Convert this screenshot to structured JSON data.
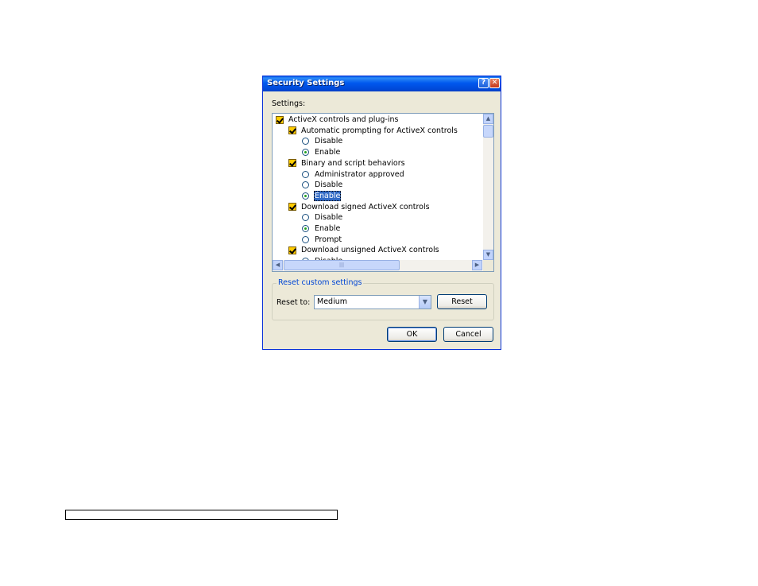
{
  "dialog": {
    "title": "Security Settings",
    "help_glyph": "?",
    "close_glyph": "✕"
  },
  "settings_label": "Settings:",
  "tree": [
    {
      "type": "category",
      "label": "ActiveX controls and plug-ins",
      "level": 0
    },
    {
      "type": "setting",
      "label": "Automatic prompting for ActiveX controls",
      "level": 1
    },
    {
      "type": "option",
      "label": "Disable",
      "selected": false
    },
    {
      "type": "option",
      "label": "Enable",
      "selected": true
    },
    {
      "type": "setting",
      "label": "Binary and script behaviors",
      "level": 1
    },
    {
      "type": "option",
      "label": "Administrator approved",
      "selected": false
    },
    {
      "type": "option",
      "label": "Disable",
      "selected": false
    },
    {
      "type": "option",
      "label": "Enable",
      "selected": true,
      "highlighted": true
    },
    {
      "type": "setting",
      "label": "Download signed ActiveX controls",
      "level": 1
    },
    {
      "type": "option",
      "label": "Disable",
      "selected": false
    },
    {
      "type": "option",
      "label": "Enable",
      "selected": true
    },
    {
      "type": "option",
      "label": "Prompt",
      "selected": false
    },
    {
      "type": "setting",
      "label": "Download unsigned ActiveX controls",
      "level": 1
    },
    {
      "type": "option",
      "label": "Disable",
      "selected": false
    }
  ],
  "scrollbar": {
    "up": "▲",
    "down": "▼",
    "left": "◀",
    "right": "▶",
    "grip": "|||"
  },
  "reset_group": {
    "title": "Reset custom settings",
    "reset_to_label": "Reset to:",
    "combo_value": "Medium",
    "combo_arrow": "▼",
    "reset_button": "Reset"
  },
  "buttons": {
    "ok": "OK",
    "cancel": "Cancel"
  }
}
